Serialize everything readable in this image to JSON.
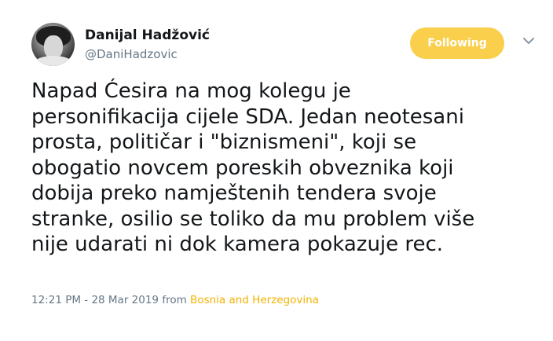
{
  "author": {
    "name": "Danijal Hadžović",
    "handle": "@DaniHadzovic"
  },
  "actions": {
    "follow_label": "Following"
  },
  "icons": {
    "menu": "chevron-down-icon"
  },
  "tweet": {
    "lines": [
      "Napad Ćesira na mog kolegu je",
      "personifikacija cijele SDA. Jedan neotesani",
      "prosta, političar i \"biznismeni\", koji se",
      "obogatio novcem poreskih obveznika koji",
      "dobija preko namještenih tendera svoje",
      "stranke, osilio se toliko da mu problem više",
      "nije udarati ni dok kamera pokazuje rec."
    ]
  },
  "meta": {
    "timestamp": "12:21 PM - 28 Mar 2019",
    "from_text": "from",
    "location": "Bosnia and Herzegovina"
  },
  "colors": {
    "follow_button": "#f9cf4b",
    "location_link": "#f3b200",
    "secondary_text": "#657786"
  }
}
